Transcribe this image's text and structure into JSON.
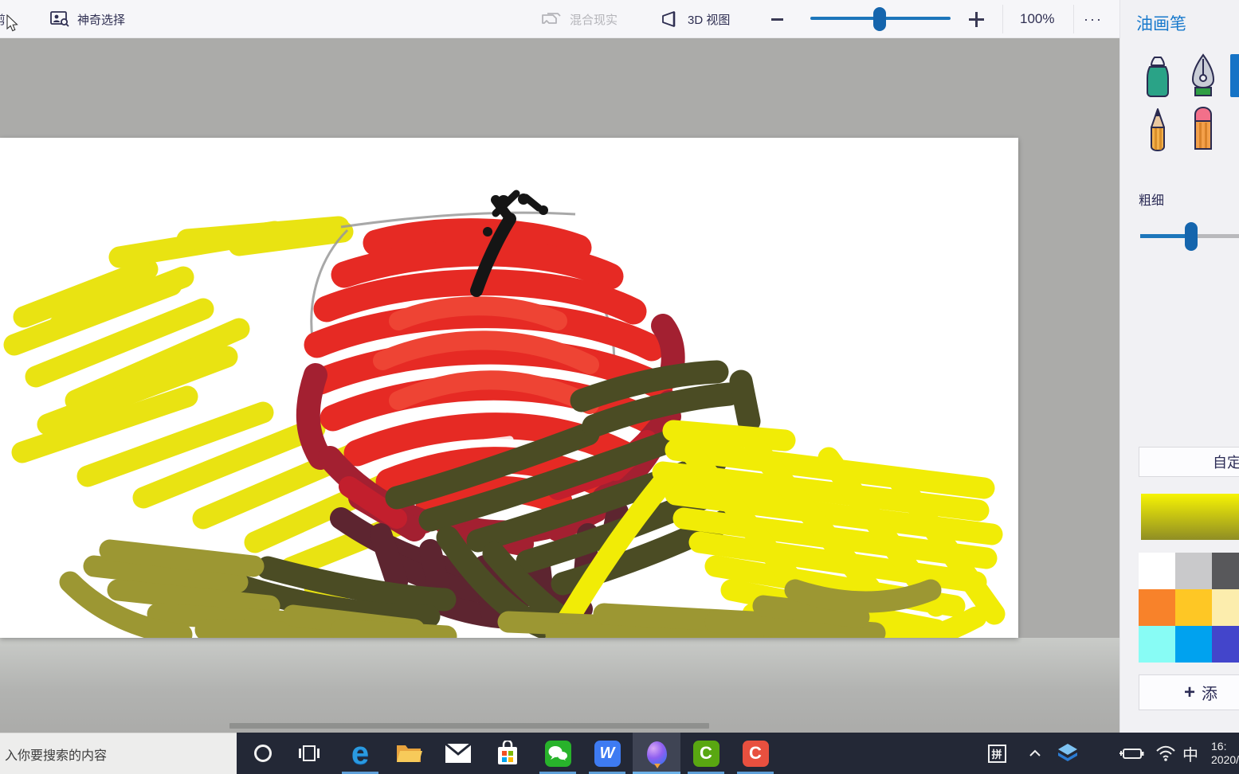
{
  "toolbar": {
    "crop_label": "剪",
    "magic_select_label": "神奇选择",
    "mixed_reality_label": "混合现实",
    "view3d_label": "3D 视图",
    "zoom_value": "100%",
    "more_label": "···"
  },
  "panel": {
    "title": "油画笔",
    "tools": [
      "marker-pen",
      "calligraphy-pen",
      "oil-brush-selected",
      "pencil",
      "eraser"
    ],
    "thickness_label": "粗细",
    "custom_button_label": "自定",
    "add_plus": "+",
    "add_label": "添",
    "selected_tool_color": "#1573c6",
    "gradient_top": "#f7f403",
    "gradient_bottom": "#8f8d24",
    "palette": [
      "#ffffff",
      "#c9c9cb",
      "#58585b",
      "#f8822a",
      "#fec725",
      "#fcedad",
      "#88fcf5",
      "#00a2ef",
      "#4345cb"
    ]
  },
  "taskbar": {
    "search_text": "入你要搜索的内容",
    "apps": [
      "edge",
      "file-explorer",
      "mail",
      "microsoft-store",
      "wechat",
      "wps-office",
      "paint-3d",
      "camtasia",
      "camtasia-recorder"
    ],
    "edge_letter": "e",
    "wps_letter": "W",
    "camtasia_letter": "C",
    "recorder_letter": "C",
    "tray": {
      "ime_badge": "拼",
      "input_mode": "中",
      "clock_time": "16:",
      "clock_date": "2020/"
    }
  }
}
